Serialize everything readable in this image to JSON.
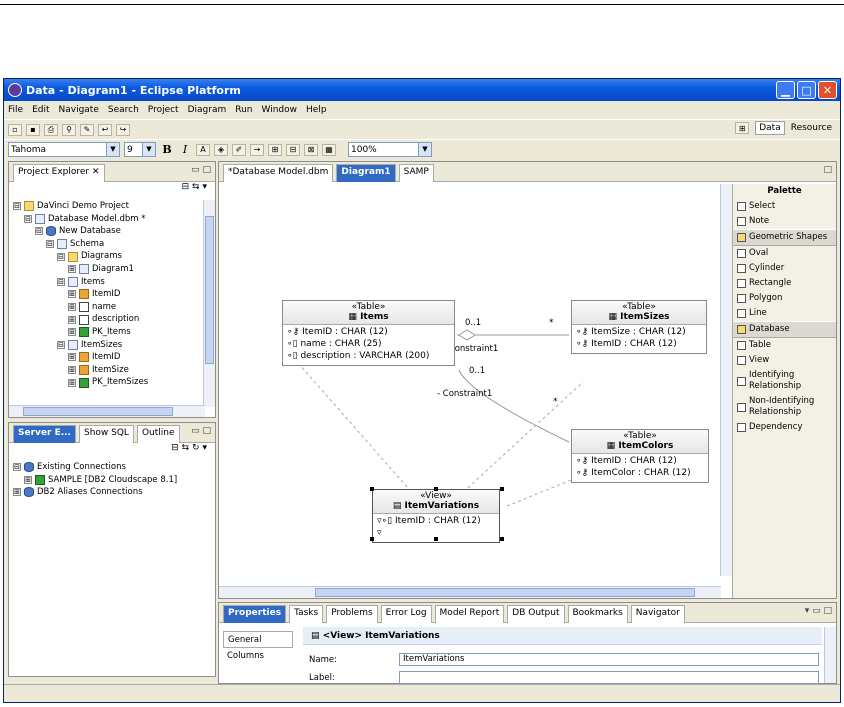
{
  "window": {
    "title": "Data - Diagram1 - Eclipse Platform"
  },
  "menu": [
    "File",
    "Edit",
    "Navigate",
    "Search",
    "Project",
    "Diagram",
    "Run",
    "Window",
    "Help"
  ],
  "toolbar": {
    "font": "Tahoma",
    "font_size": "9",
    "bold": "B",
    "italic": "I",
    "zoom": "100%"
  },
  "perspectives": {
    "data": "Data",
    "resource": "Resource"
  },
  "project_explorer": {
    "title": "Project Explorer",
    "tree": [
      {
        "label": "DaVinci Demo Project",
        "level": 0,
        "exp": "⊟",
        "icon": "folder"
      },
      {
        "label": "Database Model.dbm *",
        "level": 1,
        "exp": "⊟",
        "icon": "doc"
      },
      {
        "label": "New Database",
        "level": 2,
        "exp": "⊟",
        "icon": "db"
      },
      {
        "label": "Schema",
        "level": 3,
        "exp": "⊟",
        "icon": "doc"
      },
      {
        "label": "Diagrams",
        "level": 4,
        "exp": "⊟",
        "icon": "folder"
      },
      {
        "label": "Diagram1",
        "level": 5,
        "exp": "⊞",
        "icon": "doc"
      },
      {
        "label": "Items",
        "level": 4,
        "exp": "⊟",
        "icon": "doc"
      },
      {
        "label": "ItemID",
        "level": 5,
        "exp": "⊞",
        "icon": "key"
      },
      {
        "label": "name",
        "level": 5,
        "exp": "⊞",
        "icon": "col"
      },
      {
        "label": "description",
        "level": 5,
        "exp": "⊞",
        "icon": "col"
      },
      {
        "label": "PK_Items",
        "level": 5,
        "exp": "⊞",
        "icon": "green"
      },
      {
        "label": "ItemSizes",
        "level": 4,
        "exp": "⊟",
        "icon": "doc"
      },
      {
        "label": "ItemID",
        "level": 5,
        "exp": "⊞",
        "icon": "key"
      },
      {
        "label": "ItemSize",
        "level": 5,
        "exp": "⊞",
        "icon": "key"
      },
      {
        "label": "PK_ItemSizes",
        "level": 5,
        "exp": "⊞",
        "icon": "green"
      }
    ]
  },
  "server_panel": {
    "tabs": [
      "Server E...",
      "Show SQL",
      "Outline"
    ],
    "tree": [
      {
        "label": "Existing Connections",
        "level": 0,
        "exp": "⊟",
        "icon": "db"
      },
      {
        "label": "SAMPLE [DB2 Cloudscape 8.1]",
        "level": 1,
        "exp": "⊞",
        "icon": "green"
      },
      {
        "label": "DB2 Aliases Connections",
        "level": 0,
        "exp": "⊞",
        "icon": "db"
      }
    ]
  },
  "editor_tabs": [
    "*Database Model.dbm",
    "Diagram1",
    "SAMP"
  ],
  "diagram": {
    "tables": [
      {
        "stereo": "«Table»",
        "name": "Items",
        "fields": [
          "ItemID : CHAR (12)",
          "name : CHAR (25)",
          "description : VARCHAR (200)"
        ]
      },
      {
        "stereo": "«Table»",
        "name": "ItemSizes",
        "fields": [
          "ItemSize : CHAR (12)",
          "ItemID : CHAR (12)"
        ]
      },
      {
        "stereo": "«Table»",
        "name": "ItemColors",
        "fields": [
          "ItemID : CHAR (12)",
          "ItemColor : CHAR (12)"
        ]
      }
    ],
    "view": {
      "stereo": "«View»",
      "name": "ItemVariations",
      "fields": [
        "ItemID : CHAR (12)"
      ]
    },
    "labels": {
      "mult1": "0..1",
      "star1": "*",
      "constraint1": "- Constraint1",
      "mult2": "0..1",
      "constraint2": "- Constraint1",
      "star2": "*"
    }
  },
  "palette": {
    "title": "Palette",
    "items": [
      {
        "label": "Select",
        "group": false
      },
      {
        "label": "Note",
        "group": false
      },
      {
        "label": "Geometric Shapes",
        "group": true
      },
      {
        "label": "Oval",
        "group": false
      },
      {
        "label": "Cylinder",
        "group": false
      },
      {
        "label": "Rectangle",
        "group": false
      },
      {
        "label": "Polygon",
        "group": false
      },
      {
        "label": "Line",
        "group": false
      },
      {
        "label": "Database",
        "group": true
      },
      {
        "label": "Table",
        "group": false
      },
      {
        "label": "View",
        "group": false
      },
      {
        "label": "Identifying Relationship",
        "group": false
      },
      {
        "label": "Non-Identifying Relationship",
        "group": false
      },
      {
        "label": "Dependency",
        "group": false
      }
    ]
  },
  "bottom_tabs": [
    "Properties",
    "Tasks",
    "Problems",
    "Error Log",
    "Model Report",
    "DB Output",
    "Bookmarks",
    "Navigator"
  ],
  "properties": {
    "side_tabs": [
      "General",
      "Columns"
    ],
    "header": "<View> ItemVariations",
    "name_label": "Name:",
    "name_value": "ItemVariations",
    "label_label": "Label:"
  }
}
